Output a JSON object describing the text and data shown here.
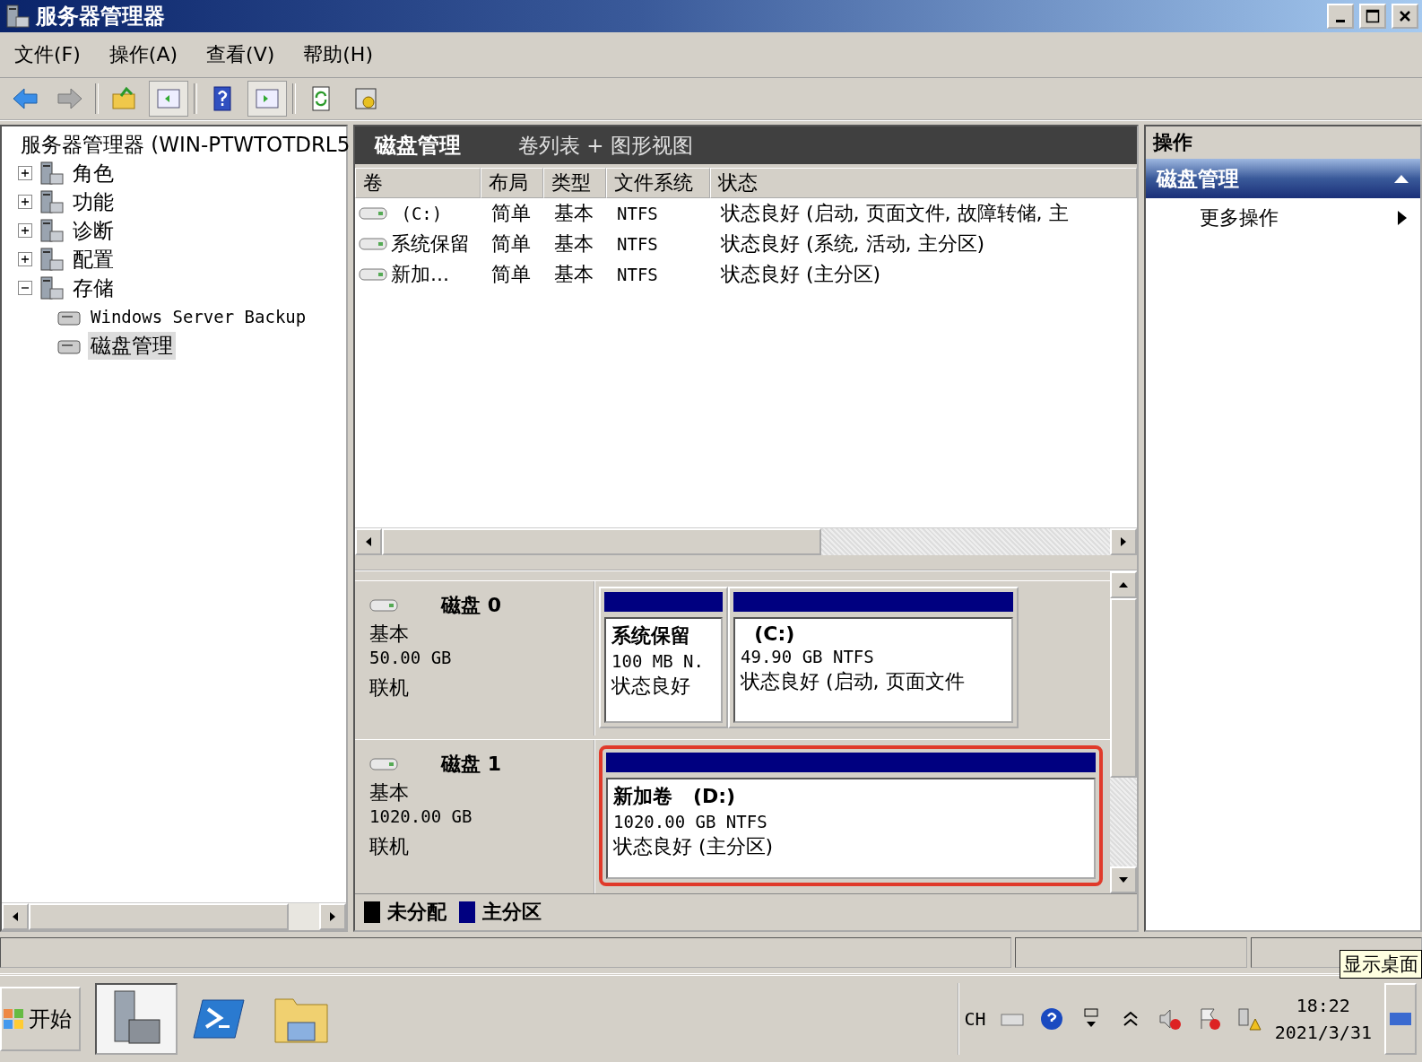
{
  "window": {
    "title": "服务器管理器"
  },
  "menu": [
    "文件(F)",
    "操作(A)",
    "查看(V)",
    "帮助(H)"
  ],
  "toolbar": [
    {
      "kind": "back",
      "pressed": false
    },
    {
      "kind": "forward",
      "pressed": false
    },
    {
      "kind": "sep"
    },
    {
      "kind": "up",
      "pressed": false
    },
    {
      "kind": "pane",
      "pressed": true
    },
    {
      "kind": "sep"
    },
    {
      "kind": "help",
      "pressed": false
    },
    {
      "kind": "pane2",
      "pressed": true
    },
    {
      "kind": "sep"
    },
    {
      "kind": "refresh",
      "pressed": false
    },
    {
      "kind": "props",
      "pressed": false
    }
  ],
  "tree": {
    "label": "服务器管理器 (WIN-PTWTOTDRL5",
    "children": [
      {
        "label": "角色",
        "expanded": false,
        "selected": false
      },
      {
        "label": "功能",
        "expanded": false,
        "selected": false
      },
      {
        "label": "诊断",
        "expanded": false,
        "selected": false
      },
      {
        "label": "配置",
        "expanded": false,
        "selected": false
      },
      {
        "label": "存储",
        "expanded": true,
        "selected": false,
        "children": [
          {
            "label": "Windows Server Backup",
            "selected": false
          },
          {
            "label": "磁盘管理",
            "selected": true
          }
        ]
      }
    ]
  },
  "center": {
    "title": "磁盘管理",
    "subtitle": "卷列表 + 图形视图",
    "columns": [
      "卷",
      "布局",
      "类型",
      "文件系统",
      "状态"
    ],
    "rows": [
      {
        "cells": [
          " (C:)",
          "简单",
          "基本",
          "NTFS",
          "状态良好 (启动, 页面文件, 故障转储, 主"
        ]
      },
      {
        "cells": [
          "系统保留",
          "简单",
          "基本",
          "NTFS",
          "状态良好 (系统, 活动, 主分区)"
        ]
      },
      {
        "cells": [
          "新加...",
          "简单",
          "基本",
          "NTFS",
          "状态良好 (主分区)"
        ]
      }
    ],
    "disks": [
      {
        "name": "磁盘 0",
        "type": "基本",
        "size": "50.00 GB",
        "status": "联机",
        "partitions": [
          {
            "title": "系统保留",
            "detail": "100 MB N.",
            "status": "状态良好",
            "highlighted": false
          },
          {
            "title": "  (C:)",
            "detail": "49.90 GB NTFS",
            "status": "状态良好 (启动, 页面文件",
            "highlighted": false
          }
        ]
      },
      {
        "name": "磁盘 1",
        "type": "基本",
        "size": "1020.00 GB",
        "status": "联机",
        "partitions": [
          {
            "title": "新加卷   (D:)",
            "detail": "1020.00 GB NTFS",
            "status": "状态良好 (主分区)",
            "highlighted": true
          }
        ]
      }
    ],
    "legend": [
      {
        "label": "未分配",
        "color": "#000000"
      },
      {
        "label": "主分区",
        "color": "#000080"
      }
    ]
  },
  "actions": {
    "title": "操作",
    "section": "磁盘管理",
    "items": [
      "更多操作"
    ]
  },
  "tooltip": "显示桌面",
  "taskbar": {
    "start": "开始",
    "apps": [
      {
        "kind": "server-manager",
        "selected": true
      },
      {
        "kind": "powershell",
        "selected": false
      },
      {
        "kind": "explorer",
        "selected": false
      }
    ],
    "language": "CH",
    "time": "18:22",
    "date": "2021/3/31"
  }
}
